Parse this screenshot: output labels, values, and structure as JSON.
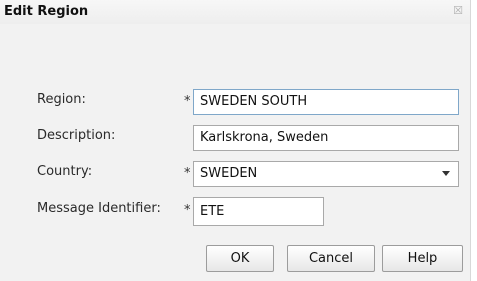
{
  "dialog": {
    "title": "Edit Region",
    "close_symbol": "☒"
  },
  "form": {
    "region": {
      "label": "Region:",
      "required_mark": "*",
      "value": "SWEDEN SOUTH"
    },
    "description": {
      "label": "Description:",
      "value": "Karlskrona, Sweden"
    },
    "country": {
      "label": "Country:",
      "required_mark": "*",
      "value": "SWEDEN"
    },
    "message_identifier": {
      "label": "Message Identifier:",
      "required_mark": "*",
      "value": "ETE"
    }
  },
  "buttons": {
    "ok": "OK",
    "cancel": "Cancel",
    "help": "Help"
  },
  "icons": {
    "close": "close-icon",
    "dropdown": "chevron-down-icon"
  }
}
